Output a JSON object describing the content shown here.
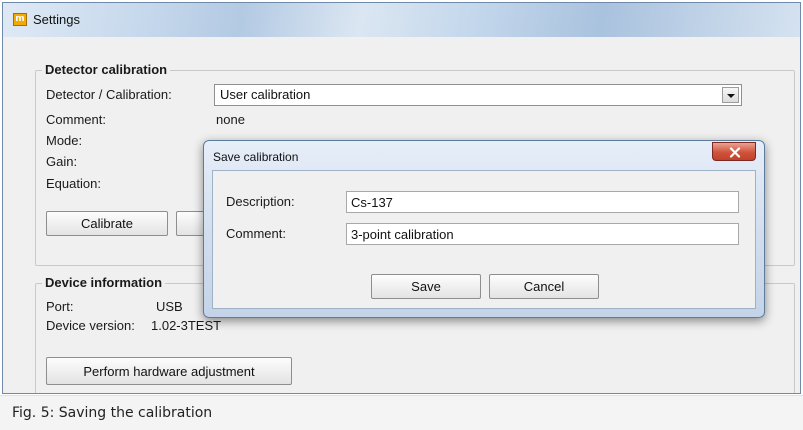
{
  "window": {
    "title": "Settings",
    "icon": "app-m-icon"
  },
  "detector_calibration": {
    "legend": "Detector calibration",
    "detector_label": "Detector / Calibration:",
    "detector_value": "User calibration",
    "comment_label": "Comment:",
    "comment_value": "none",
    "mode_label": "Mode:",
    "gain_label": "Gain:",
    "equation_label": "Equation:",
    "calibrate_button": "Calibrate"
  },
  "device_information": {
    "legend": "Device information",
    "port_label": "Port:",
    "port_value": "USB",
    "version_label": "Device version:",
    "version_value": "1.02-3TEST",
    "adjust_button": "Perform hardware adjustment"
  },
  "save_dialog": {
    "title": "Save calibration",
    "description_label": "Description:",
    "description_value": "Cs-137",
    "comment_label": "Comment:",
    "comment_value": "3-point calibration",
    "save_button": "Save",
    "cancel_button": "Cancel",
    "close_icon": "close-icon"
  },
  "caption": "Fig. 5: Saving the calibration",
  "colors": {
    "close_button": "#c84a33",
    "title_bar": "#c6d8ec",
    "dialog_frame": "#cfdced"
  }
}
